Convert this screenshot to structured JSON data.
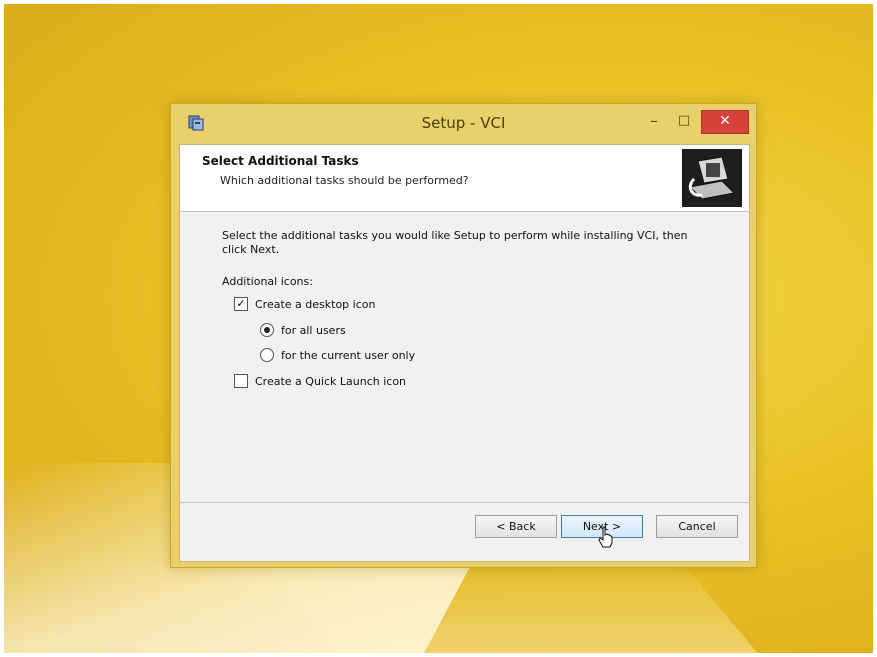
{
  "window": {
    "title": "Setup - VCI",
    "controls": {
      "minimize": "–",
      "maximize": "□",
      "close": "✕"
    }
  },
  "header": {
    "title": "Select Additional Tasks",
    "subtitle": "Which additional tasks should be performed?"
  },
  "content": {
    "instruction": "Select the additional tasks you would like Setup to perform while installing VCI, then click Next.",
    "section_label": "Additional icons:",
    "options": {
      "desktop_icon": {
        "label": "Create a desktop icon",
        "checked": true
      },
      "all_users": {
        "label": "for all users",
        "selected": true
      },
      "current_user": {
        "label": "for the current user only",
        "selected": false
      },
      "quick_launch": {
        "label": "Create a Quick Launch icon",
        "checked": false
      }
    }
  },
  "buttons": {
    "back": "< Back",
    "next": "Next >",
    "cancel": "Cancel"
  },
  "colors": {
    "desktop": "#e8c125",
    "window_frame": "#e9d06a",
    "close_button": "#d5433a",
    "client_bg": "#f1f1f1"
  }
}
